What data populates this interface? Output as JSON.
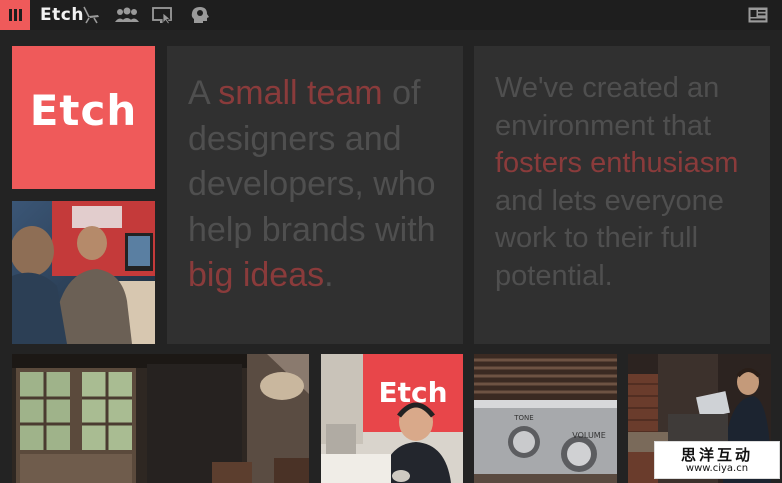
{
  "header": {
    "logo_text": "Etch",
    "menu_icon": "hamburger-icon",
    "nav_icons": [
      "chair-icon",
      "team-icon",
      "screen-cursor-icon",
      "head-idea-icon"
    ],
    "profile_icon": "id-card-icon"
  },
  "brand": {
    "accent": "#ef5a5a",
    "highlight": "#8a3b3b",
    "panel_bg": "#303030",
    "page_bg": "#232323",
    "text_dim": "#4f4f4f"
  },
  "logo_tile": {
    "text": "Etch"
  },
  "panel_team": {
    "intro": "A ",
    "hl1": "small team",
    "mid": " of designers and developers, who help brands with ",
    "hl2": "big ideas",
    "end": "."
  },
  "panel_culture": {
    "intro": "We've created an environment that ",
    "hl": "fosters enthusiasm",
    "end": " and lets everyone work to their full potential."
  },
  "photos": [
    "office-workers-photo",
    "studio-doors-photo",
    "headphones-worker-photo",
    "vintage-radio-photo",
    "laptop-man-photo"
  ],
  "watermark": {
    "cn": "思洋互动",
    "url": "www.ciya.cn"
  }
}
